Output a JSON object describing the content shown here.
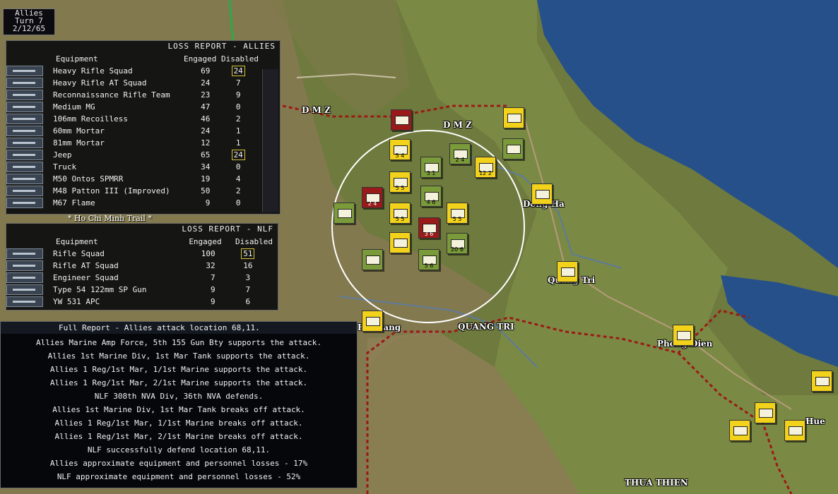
{
  "turn": {
    "side": "Allies",
    "turn": "Turn 7",
    "date": "2/12/65"
  },
  "map_labels": {
    "dmz_left": "D M Z",
    "dmz_center": "D M Z",
    "dong_ha": "Dong Ha",
    "quang_tri_city": "Quang Tri",
    "quang_tri": "QUANG TRI",
    "phong_dien": "Phong Dien",
    "thua_thien": "THUA THIEN",
    "hai_lang": "Hai Lang",
    "hue": "Hue"
  },
  "allies_report": {
    "title": "LOSS REPORT  -  ALLIES",
    "headers": {
      "equipment": "Equipment",
      "engaged": "Engaged",
      "disabled": "Disabled"
    },
    "rows": [
      {
        "name": "Heavy Rifle Squad",
        "engaged": "69",
        "disabled": "24",
        "highlight": true
      },
      {
        "name": "Heavy Rifle AT Squad",
        "engaged": "24",
        "disabled": "7",
        "highlight": false
      },
      {
        "name": "Reconnaissance Rifle Team",
        "engaged": "23",
        "disabled": "9",
        "highlight": false
      },
      {
        "name": "Medium MG",
        "engaged": "47",
        "disabled": "0",
        "highlight": false
      },
      {
        "name": "106mm Recoilless",
        "engaged": "46",
        "disabled": "2",
        "highlight": false
      },
      {
        "name": "60mm Mortar",
        "engaged": "24",
        "disabled": "1",
        "highlight": false
      },
      {
        "name": "81mm Mortar",
        "engaged": "12",
        "disabled": "1",
        "highlight": false
      },
      {
        "name": "Jeep",
        "engaged": "65",
        "disabled": "24",
        "highlight": true
      },
      {
        "name": "Truck",
        "engaged": "34",
        "disabled": "0",
        "highlight": false
      },
      {
        "name": "M50 Ontos SPMRR",
        "engaged": "19",
        "disabled": "4",
        "highlight": false
      },
      {
        "name": "M48 Patton III (Improved)",
        "engaged": "50",
        "disabled": "2",
        "highlight": false
      },
      {
        "name": "M67 Flame",
        "engaged": "9",
        "disabled": "0",
        "highlight": false
      }
    ]
  },
  "trail_caption": "* Ho Chi Minh Trail *",
  "nlf_report": {
    "title": "LOSS REPORT  -  NLF",
    "headers": {
      "equipment": "Equipment",
      "engaged": "Engaged",
      "disabled": "Disabled"
    },
    "rows": [
      {
        "name": "Rifle Squad",
        "engaged": "100",
        "disabled": "51",
        "highlight": true
      },
      {
        "name": "Rifle AT Squad",
        "engaged": "32",
        "disabled": "16",
        "highlight": false
      },
      {
        "name": "Engineer Squad",
        "engaged": "7",
        "disabled": "3",
        "highlight": false
      },
      {
        "name": "Type 54 122mm SP Gun",
        "engaged": "9",
        "disabled": "7",
        "highlight": false
      },
      {
        "name": "YW 531 APC",
        "engaged": "9",
        "disabled": "6",
        "highlight": false
      }
    ]
  },
  "full_report": {
    "title": "Full Report -  Allies attack location 68,11.",
    "lines": [
      "Allies Marine Amp Force, 5th 155 Gun Bty supports the attack.",
      "Allies 1st Marine Div, 1st Mar Tank supports the attack.",
      "Allies 1 Reg/1st Mar, 1/1st Marine supports the attack.",
      "Allies 1 Reg/1st Mar, 2/1st Marine supports the attack.",
      "NLF 308th NVA Div, 36th NVA defends.",
      "Allies 1st Marine Div, 1st Mar Tank breaks off attack.",
      "Allies 1 Reg/1st Mar, 1/1st Marine breaks off attack.",
      "Allies 1 Reg/1st Mar, 2/1st Marine breaks off attack.",
      "NLF successfully defend location 68,11.",
      "Allies approximate equipment and personnel losses - 17%",
      "NLF approximate equipment and personnel losses - 52%"
    ]
  },
  "counters": [
    {
      "id": "red-1",
      "color": "red",
      "numbers": ""
    },
    {
      "id": "yellow-1",
      "color": "yellow",
      "numbers": "5 4"
    },
    {
      "id": "green-1",
      "color": "green",
      "numbers": "3 1"
    },
    {
      "id": "green-2",
      "color": "green",
      "numbers": "2 4"
    },
    {
      "id": "yellow-2",
      "color": "yellow",
      "numbers": "12 2"
    },
    {
      "id": "yellow-3",
      "color": "yellow",
      "numbers": ""
    },
    {
      "id": "green-3",
      "color": "green",
      "numbers": ""
    },
    {
      "id": "red-2",
      "color": "red",
      "numbers": "2 4"
    },
    {
      "id": "yellow-4",
      "color": "yellow",
      "numbers": "5 5"
    },
    {
      "id": "green-4",
      "color": "green",
      "numbers": "4 6"
    },
    {
      "id": "yellow-5",
      "color": "yellow",
      "numbers": "5 5"
    },
    {
      "id": "red-3",
      "color": "red",
      "numbers": "3 6"
    },
    {
      "id": "green-5",
      "color": "green",
      "numbers": ""
    },
    {
      "id": "yellow-6",
      "color": "yellow",
      "numbers": "5 5"
    },
    {
      "id": "green-6",
      "color": "green",
      "numbers": "20 6"
    },
    {
      "id": "green-7",
      "color": "green",
      "numbers": "5 6"
    },
    {
      "id": "green-8",
      "color": "green",
      "numbers": ""
    },
    {
      "id": "yellow-7",
      "color": "yellow",
      "numbers": ""
    },
    {
      "id": "yellow-8",
      "color": "yellow",
      "numbers": ""
    },
    {
      "id": "yellow-9",
      "color": "yellow",
      "numbers": ""
    },
    {
      "id": "yellow-10",
      "color": "yellow",
      "numbers": ""
    },
    {
      "id": "yellow-11",
      "color": "yellow",
      "numbers": ""
    },
    {
      "id": "yellow-12",
      "color": "yellow",
      "numbers": ""
    },
    {
      "id": "yellow-13",
      "color": "yellow",
      "numbers": ""
    },
    {
      "id": "yellow-14",
      "color": "yellow",
      "numbers": ""
    },
    {
      "id": "yellow-15",
      "color": "yellow",
      "numbers": ""
    }
  ],
  "colors": {
    "allied_yellow": "#f2d21a",
    "nva_green": "#7b9a3a",
    "nva_red": "#9a1a1a",
    "sea": "#25508a",
    "border_dash": "#9b1a14"
  }
}
